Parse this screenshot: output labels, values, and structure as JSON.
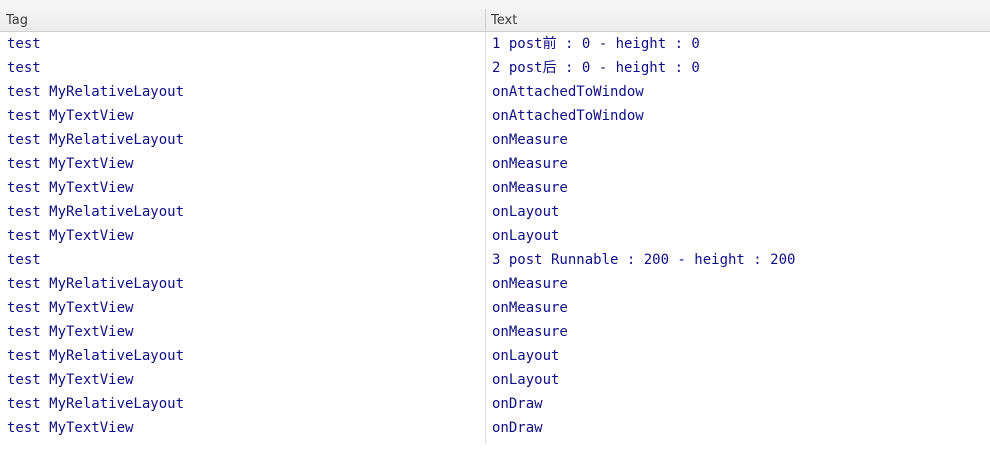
{
  "columns": {
    "tag": "Tag",
    "text": "Text"
  },
  "rows": [
    {
      "tag": "test",
      "text": "1 post前 : 0 - height : 0"
    },
    {
      "tag": "test",
      "text": "2 post后 : 0 - height : 0"
    },
    {
      "tag": "test MyRelativeLayout",
      "text": "onAttachedToWindow"
    },
    {
      "tag": "test MyTextView",
      "text": "onAttachedToWindow"
    },
    {
      "tag": "test MyRelativeLayout",
      "text": "onMeasure"
    },
    {
      "tag": "test MyTextView",
      "text": "onMeasure"
    },
    {
      "tag": "test MyTextView",
      "text": "onMeasure"
    },
    {
      "tag": "test MyRelativeLayout",
      "text": "onLayout"
    },
    {
      "tag": "test MyTextView",
      "text": "onLayout"
    },
    {
      "tag": "test",
      "text": "3 post Runnable : 200 - height : 200"
    },
    {
      "tag": "test MyRelativeLayout",
      "text": "onMeasure"
    },
    {
      "tag": "test MyTextView",
      "text": "onMeasure"
    },
    {
      "tag": "test MyTextView",
      "text": "onMeasure"
    },
    {
      "tag": "test MyRelativeLayout",
      "text": "onLayout"
    },
    {
      "tag": "test MyTextView",
      "text": "onLayout"
    },
    {
      "tag": "test MyRelativeLayout",
      "text": "onDraw"
    },
    {
      "tag": "test MyTextView",
      "text": "onDraw"
    }
  ],
  "colors": {
    "text": "#0f0f86",
    "header_text": "#3c3c3c",
    "header_bg": "#efefef"
  }
}
